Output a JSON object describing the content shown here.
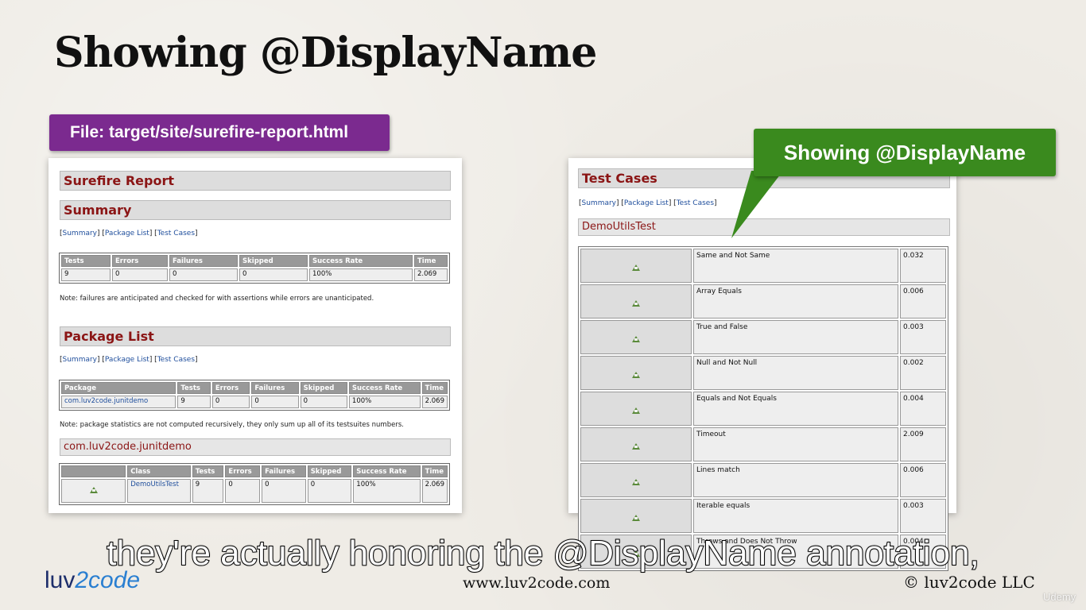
{
  "title": "Showing @DisplayName",
  "file_banner": "File: target/site/surefire-report.html",
  "left_report": {
    "report_title": "Surefire Report",
    "summary_heading": "Summary",
    "links": {
      "summary": "Summary",
      "package_list": "Package List",
      "test_cases": "Test Cases"
    },
    "summary_table": {
      "headers": [
        "Tests",
        "Errors",
        "Failures",
        "Skipped",
        "Success Rate",
        "Time"
      ],
      "row": [
        "9",
        "0",
        "0",
        "0",
        "100%",
        "2.069"
      ]
    },
    "summary_note": "Note: failures are anticipated and checked for with assertions while errors are unanticipated.",
    "package_list_heading": "Package List",
    "package_table": {
      "headers": [
        "Package",
        "Tests",
        "Errors",
        "Failures",
        "Skipped",
        "Success Rate",
        "Time"
      ],
      "row": [
        "com.luv2code.junitdemo",
        "9",
        "0",
        "0",
        "0",
        "100%",
        "2.069"
      ]
    },
    "package_note": "Note: package statistics are not computed recursively, they only sum up all of its testsuites numbers.",
    "package_heading": "com.luv2code.junitdemo",
    "class_table": {
      "headers": [
        "",
        "Class",
        "Tests",
        "Errors",
        "Failures",
        "Skipped",
        "Success Rate",
        "Time"
      ],
      "row": [
        "DemoUtilsTest",
        "9",
        "0",
        "0",
        "0",
        "100%",
        "2.069"
      ]
    }
  },
  "right_report": {
    "heading": "Test Cases",
    "links": {
      "summary": "Summary",
      "package_list": "Package List",
      "test_cases": "Test Cases"
    },
    "class_heading": "DemoUtilsTest",
    "test_cases": [
      {
        "name": "Same and Not Same",
        "time": "0.032"
      },
      {
        "name": "Array Equals",
        "time": "0.006"
      },
      {
        "name": "True and False",
        "time": "0.003"
      },
      {
        "name": "Null and Not Null",
        "time": "0.002"
      },
      {
        "name": "Equals and Not Equals",
        "time": "0.004"
      },
      {
        "name": "Timeout",
        "time": "2.009"
      },
      {
        "name": "Lines match",
        "time": "0.006"
      },
      {
        "name": "Iterable equals",
        "time": "0.003"
      },
      {
        "name": "Throws and Does Not Throw",
        "time": "0.004"
      }
    ]
  },
  "callout": "Showing @DisplayName",
  "caption": "they're actually honoring the @DisplayName annotation,",
  "footer": {
    "logo_part1": "luv",
    "logo_part2": "2code",
    "website": "www.luv2code.com",
    "copyright": "© luv2code LLC",
    "watermark": "Udemy"
  },
  "colors": {
    "banner_purple": "#7b2a8f",
    "callout_green": "#3a8a1e",
    "heading_red": "#8b1515",
    "link_blue": "#1f4e9c",
    "pass_icon_green": "#5a8a3a"
  },
  "icons": {
    "pass": "success-triangle-icon"
  }
}
